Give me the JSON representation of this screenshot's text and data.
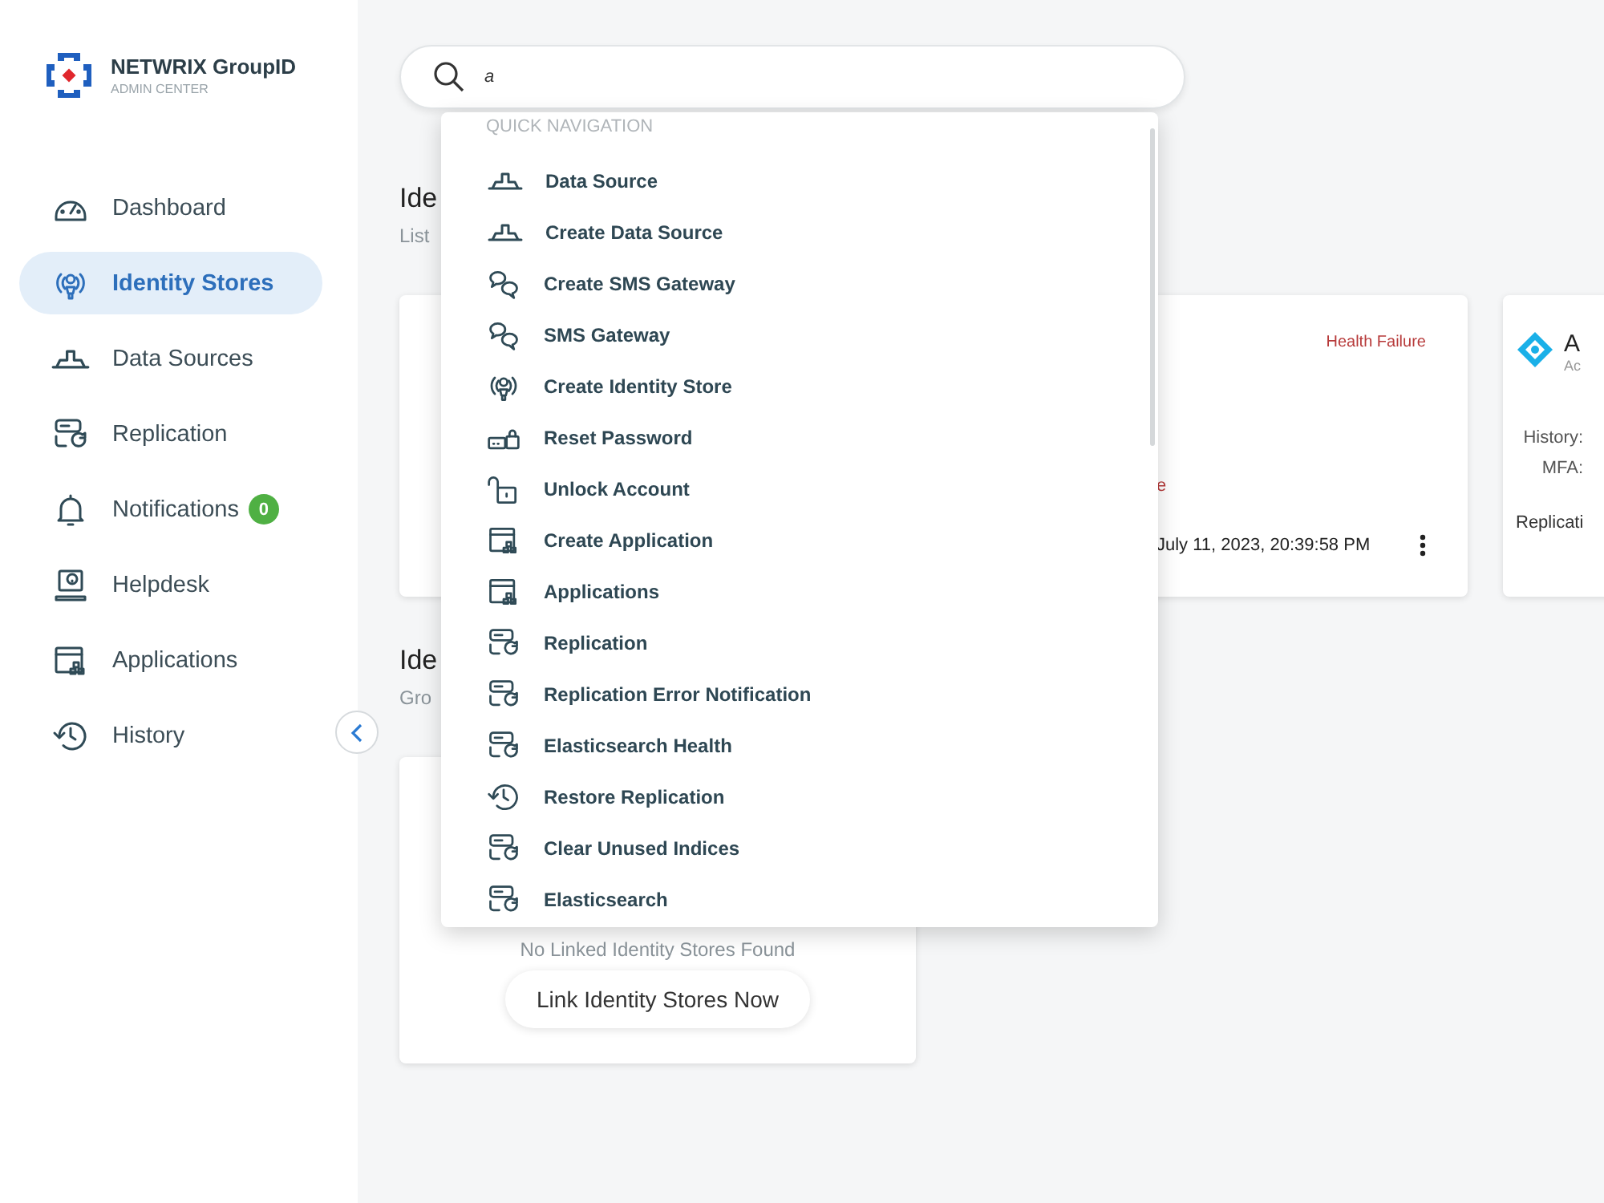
{
  "brand": {
    "name": "NETWRIX GroupID",
    "subtitle": "ADMIN CENTER"
  },
  "sidebar": {
    "items": [
      {
        "label": "Dashboard",
        "kind": "dashboard",
        "selected": false
      },
      {
        "label": "Identity Stores",
        "kind": "identity",
        "selected": true
      },
      {
        "label": "Data Sources",
        "kind": "datasource",
        "selected": false
      },
      {
        "label": "Replication",
        "kind": "replication",
        "selected": false
      },
      {
        "label": "Notifications",
        "kind": "bell",
        "selected": false,
        "badge": "0"
      },
      {
        "label": "Helpdesk",
        "kind": "helpdesk",
        "selected": false
      },
      {
        "label": "Applications",
        "kind": "app",
        "selected": false
      },
      {
        "label": "History",
        "kind": "history",
        "selected": false
      }
    ]
  },
  "search": {
    "value": "a"
  },
  "quick_navigation": {
    "heading": "QUICK NAVIGATION",
    "items": [
      {
        "label": "Data Source",
        "kind": "datasource"
      },
      {
        "label": "Create Data Source",
        "kind": "datasource"
      },
      {
        "label": "Create SMS Gateway",
        "kind": "sms"
      },
      {
        "label": "SMS Gateway",
        "kind": "sms"
      },
      {
        "label": "Create Identity Store",
        "kind": "identity"
      },
      {
        "label": "Reset Password",
        "kind": "reset"
      },
      {
        "label": "Unlock Account",
        "kind": "unlock"
      },
      {
        "label": "Create Application",
        "kind": "app"
      },
      {
        "label": "Applications",
        "kind": "app"
      },
      {
        "label": "Replication",
        "kind": "replication"
      },
      {
        "label": "Replication Error Notification",
        "kind": "replication"
      },
      {
        "label": "Elasticsearch Health",
        "kind": "replication"
      },
      {
        "label": "Restore Replication",
        "kind": "history"
      },
      {
        "label": "Clear Unused Indices",
        "kind": "replication"
      },
      {
        "label": "Elasticsearch",
        "kind": "replication"
      }
    ]
  },
  "sections": [
    {
      "title": "Ide",
      "subtitle": "List",
      "cards": [
        {
          "kind": "hidden"
        },
        {
          "kind": "status",
          "status": "Health Failure",
          "fragment": "e",
          "date": "July 11, 2023, 20:39:58 PM"
        },
        {
          "kind": "store",
          "title": "A",
          "subtitle": "Ac",
          "fields": [
            "History:",
            "MFA:"
          ],
          "footer": "Replicati"
        }
      ]
    },
    {
      "title": "Ide",
      "subtitle": "Gro",
      "cards": [
        {
          "kind": "empty",
          "message": "No Linked Identity Stores Found",
          "button": "Link Identity Stores Now"
        }
      ]
    }
  ]
}
